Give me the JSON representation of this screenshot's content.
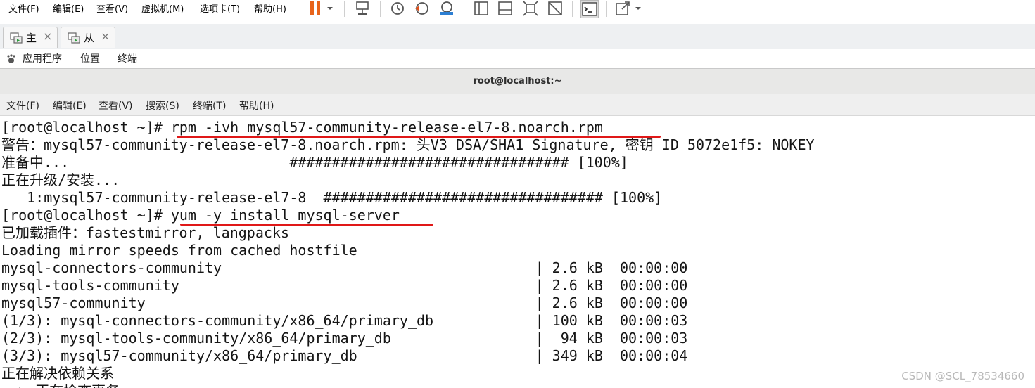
{
  "vm_menu": [
    {
      "label": "文件(F)"
    },
    {
      "label": "编辑(E)"
    },
    {
      "label": "查看(V)"
    },
    {
      "label": "虚拟机(M)"
    },
    {
      "label": "选项卡(T)"
    },
    {
      "label": "帮助(H)"
    }
  ],
  "vm_toolbar_icons": [
    "pause-icon",
    "send-ctrl-alt-del-icon",
    "snapshot-icon",
    "revert-snapshot-icon",
    "snapshot-manager-icon",
    "single-window-icon",
    "no-tabs-icon",
    "fit-guest-icon",
    "fullscreen-off-icon",
    "console-icon",
    "stretch-icon"
  ],
  "vm_tabs": [
    {
      "label": "主",
      "close": "×"
    },
    {
      "label": "从",
      "close": "×"
    }
  ],
  "gnome": {
    "applications": "应用程序",
    "places": "位置",
    "terminal": "终端"
  },
  "terminal": {
    "title": "root@localhost:~",
    "menu": [
      {
        "label": "文件(F)"
      },
      {
        "label": "编辑(E)"
      },
      {
        "label": "查看(V)"
      },
      {
        "label": "搜索(S)"
      },
      {
        "label": "终端(T)"
      },
      {
        "label": "帮助(H)"
      }
    ],
    "lines": [
      "[root@localhost ~]# rpm -ivh mysql57-community-release-el7-8.noarch.rpm",
      "警告：mysql57-community-release-el7-8.noarch.rpm: 头V3 DSA/SHA1 Signature, 密钥 ID 5072e1f5: NOKEY",
      "准备中...                          ################################# [100%]",
      "正在升级/安装...",
      "   1:mysql57-community-release-el7-8  ################################# [100%]",
      "[root@localhost ~]# yum -y install mysql-server",
      "已加载插件：fastestmirror, langpacks",
      "Loading mirror speeds from cached hostfile",
      "mysql-connectors-community                                     | 2.6 kB  00:00:00",
      "mysql-tools-community                                          | 2.6 kB  00:00:00",
      "mysql57-community                                              | 2.6 kB  00:00:00",
      "(1/3): mysql-connectors-community/x86_64/primary_db            | 100 kB  00:00:03",
      "(2/3): mysql-tools-community/x86_64/primary_db                 |  94 kB  00:00:03",
      "(3/3): mysql57-community/x86_64/primary_db                     | 349 kB  00:00:04",
      "正在解决依赖关系",
      "--> 正在检查事务"
    ]
  },
  "annotation_color": "#e01818",
  "watermark": "CSDN @SCL_78534660"
}
